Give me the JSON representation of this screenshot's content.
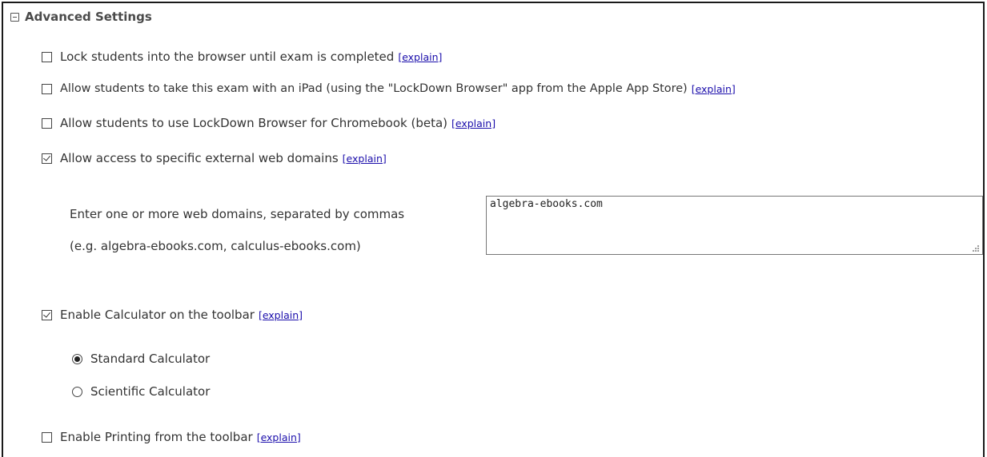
{
  "section": {
    "title": "Advanced Settings",
    "collapse_icon": "minus-box-icon"
  },
  "explain_label": "[explain]",
  "options": {
    "lock_browser": {
      "label": "Lock students into the browser until exam is completed",
      "checked": false
    },
    "ipad": {
      "label": "Allow students to take this exam with an iPad (using the \"LockDown Browser\" app from the Apple App Store)",
      "checked": false
    },
    "chromebook": {
      "label": "Allow students to use LockDown Browser for Chromebook (beta)",
      "checked": false
    },
    "external_domains": {
      "label": "Allow access to specific external web domains",
      "checked": true
    },
    "calculator": {
      "label": "Enable Calculator on the toolbar",
      "checked": true
    },
    "printing": {
      "label": "Enable Printing from the toolbar",
      "checked": false
    }
  },
  "domains": {
    "instruction": "Enter one or more web domains, separated by commas",
    "example": "(e.g. algebra-ebooks.com, calculus-ebooks.com)",
    "value": "algebra-ebooks.com"
  },
  "calculator_types": [
    {
      "label": "Standard Calculator",
      "selected": true
    },
    {
      "label": "Scientific Calculator",
      "selected": false
    }
  ]
}
